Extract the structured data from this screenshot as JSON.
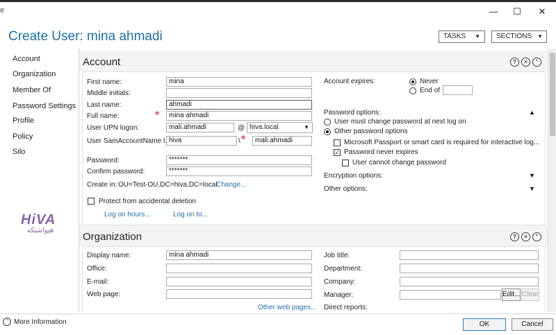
{
  "window": {
    "left_glyph": "e",
    "minimize_glyph": "—",
    "maximize_glyph": "☐",
    "close_glyph": "✕"
  },
  "header": {
    "title": "Create User: mina ahmadi",
    "tasks_label": "TASKS",
    "sections_label": "SECTIONS"
  },
  "nav": {
    "items": [
      {
        "label": "Account"
      },
      {
        "label": "Organization"
      },
      {
        "label": "Member Of"
      },
      {
        "label": "Password Settings"
      },
      {
        "label": "Profile"
      },
      {
        "label": "Policy"
      },
      {
        "label": "Silo"
      }
    ],
    "logo_top": "HiVA",
    "logo_bottom": "هیواشبکه"
  },
  "account": {
    "title": "Account",
    "first_name_label": "First name:",
    "first_name": "mina",
    "middle_initials_label": "Middle initials:",
    "middle_initials": "",
    "last_name_label": "Last name:",
    "last_name": "ahmadi",
    "full_name_label": "Full name:",
    "full_name": "mina ahmadi",
    "upn_label": "User UPN logon:",
    "upn_user": "mali.ahmadi",
    "upn_at": "@",
    "upn_domain": "hiva.local",
    "sam_label": "User SamAccountName l...",
    "sam_domain": "hiva",
    "sam_sep": "\\",
    "sam_user": "mali.ahmadi",
    "password_label": "Password:",
    "password": "*******",
    "confirm_password_label": "Confirm password:",
    "confirm_password": "*******",
    "create_in_label": "Create in:",
    "create_in_value": "OU=Test-OU,DC=hiva,DC=local",
    "change_link": "Change...",
    "protect_label": "Protect from accidental deletion",
    "logon_hours_link": "Log on hours...",
    "logon_to_link": "Log on to...",
    "account_expires_label": "Account expires:",
    "never_label": "Never",
    "end_of_label": "End of",
    "password_options_label": "Password options:",
    "must_change_label": "User must change password at next log on",
    "other_options_label": "Other password options",
    "passport_label": "Microsoft Passport or smart card is required for interactive log...",
    "never_expires_label": "Password never expires",
    "cannot_change_label": "User cannot change password",
    "encryption_label": "Encryption options:",
    "other_label": "Other options:"
  },
  "organization": {
    "title": "Organization",
    "display_name_label": "Display name:",
    "display_name": "mina ahmadi",
    "office_label": "Office:",
    "email_label": "E-mail:",
    "web_page_label": "Web page:",
    "other_web_link": "Other web pages...",
    "job_title_label": "Job title:",
    "department_label": "Department:",
    "company_label": "Company:",
    "manager_label": "Manager:",
    "edit_label": "Edit...",
    "clear_label": "Clear",
    "direct_reports_label": "Direct reports:"
  },
  "footer": {
    "more_info": "More Information",
    "ok": "OK",
    "cancel": "Cancel"
  }
}
